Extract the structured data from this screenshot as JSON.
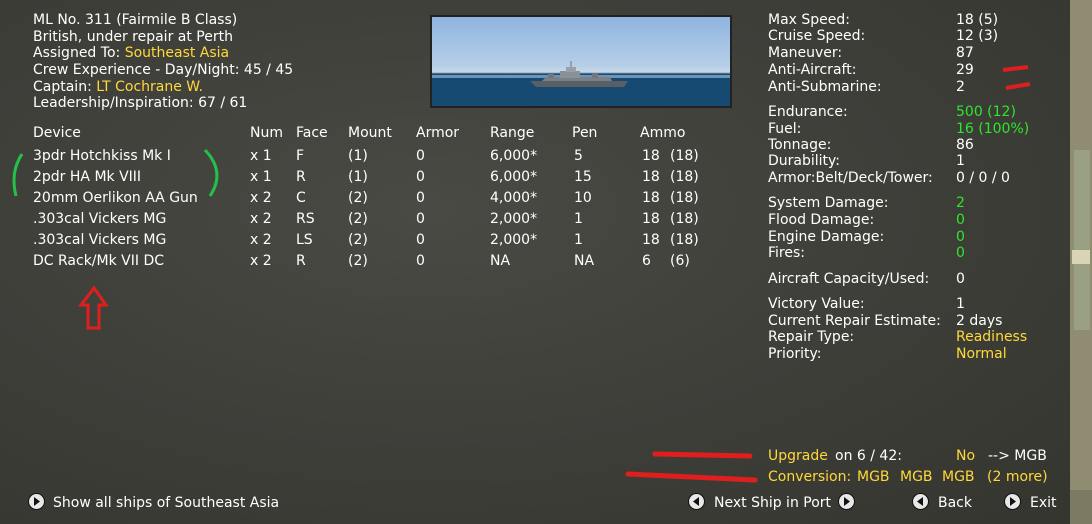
{
  "ship": {
    "line1": "ML No. 311 (Fairmile B Class)",
    "line2": "British, under repair at Perth",
    "assigned_label": "Assigned To:",
    "assigned_value": "Southeast Asia",
    "crew_label": "Crew Experience - Day/Night:",
    "crew_value": "45 / 45",
    "captain_label": "Captain:",
    "captain_value": "LT Cochrane W.",
    "leadership_label": "Leadership/Inspiration:",
    "leadership_value": "67 / 61"
  },
  "devices": {
    "headers": [
      "Device",
      "Num",
      "Face",
      "Mount",
      "Armor",
      "Range",
      "Pen",
      "Ammo"
    ],
    "rows": [
      {
        "device": "3pdr Hotchkiss Mk I",
        "num": "x 1",
        "face": "F",
        "mount": "(1)",
        "armor": "0",
        "range": "6,000*",
        "pen": "5",
        "ammo": "18",
        "ammo2": "(18)"
      },
      {
        "device": "2pdr HA Mk VIII",
        "num": "x 1",
        "face": "R",
        "mount": "(1)",
        "armor": "0",
        "range": "6,000*",
        "pen": "15",
        "ammo": "18",
        "ammo2": "(18)"
      },
      {
        "device": "20mm Oerlikon AA Gun",
        "num": "x 2",
        "face": "C",
        "mount": "(2)",
        "armor": "0",
        "range": "4,000*",
        "pen": "10",
        "ammo": "18",
        "ammo2": "(18)"
      },
      {
        "device": ".303cal Vickers MG",
        "num": "x 2",
        "face": "RS",
        "mount": "(2)",
        "armor": "0",
        "range": "2,000*",
        "pen": "1",
        "ammo": "18",
        "ammo2": "(18)"
      },
      {
        "device": ".303cal Vickers MG",
        "num": "x 2",
        "face": "LS",
        "mount": "(2)",
        "armor": "0",
        "range": "2,000*",
        "pen": "1",
        "ammo": "18",
        "ammo2": "(18)"
      },
      {
        "device": "DC Rack/Mk VII DC",
        "num": "x 2",
        "face": "R",
        "mount": "(2)",
        "armor": "0",
        "range": "NA",
        "pen": "NA",
        "ammo": "6",
        "ammo2": "(6)"
      }
    ]
  },
  "stats": {
    "max_speed_label": "Max Speed:",
    "max_speed": "18 (5)",
    "cruise_speed_label": "Cruise Speed:",
    "cruise_speed": "12 (3)",
    "maneuver_label": "Maneuver:",
    "maneuver": "87",
    "anti_aircraft_label": "Anti-Aircraft:",
    "anti_aircraft": "29",
    "anti_sub_label": "Anti-Submarine:",
    "anti_sub": "2",
    "endurance_label": "Endurance:",
    "endurance": "500 (12)",
    "fuel_label": "Fuel:",
    "fuel": "16 (100%)",
    "tonnage_label": "Tonnage:",
    "tonnage": "86",
    "durability_label": "Durability:",
    "durability": "1",
    "armor_label": "Armor:Belt/Deck/Tower:",
    "armor": "0 / 0 / 0",
    "system_damage_label": "System Damage:",
    "system_damage": "2",
    "flood_damage_label": "Flood Damage:",
    "flood_damage": "0",
    "engine_damage_label": "Engine Damage:",
    "engine_damage": "0",
    "fires_label": "Fires:",
    "fires": "0",
    "aircraft_label": "Aircraft Capacity/Used:",
    "aircraft": "0",
    "victory_label": "Victory Value:",
    "victory": "1",
    "repair_est_label": "Current Repair Estimate:",
    "repair_est": "2 days",
    "repair_type_label": "Repair Type:",
    "repair_type": "Readiness",
    "priority_label": "Priority:",
    "priority": "Normal"
  },
  "upgrade": {
    "upgrade_link": "Upgrade",
    "upgrade_text": "on 6 / 42:",
    "upgrade_value": "No",
    "upgrade_arrow": "--> MGB",
    "conversion_link": "Conversion:",
    "conv1": "MGB",
    "conv2": "MGB",
    "conv3": "MGB",
    "conv_more": "(2 more)"
  },
  "footer": {
    "show_all": "Show all ships of Southeast Asia",
    "next_ship": "Next Ship in Port",
    "back": "Back",
    "exit": "Exit"
  },
  "colors": {
    "label": "#ffffff",
    "highlight": "#ffd83a",
    "good": "#2ee52e",
    "annotation_red": "#e01e1e",
    "annotation_green": "#22c24a"
  }
}
